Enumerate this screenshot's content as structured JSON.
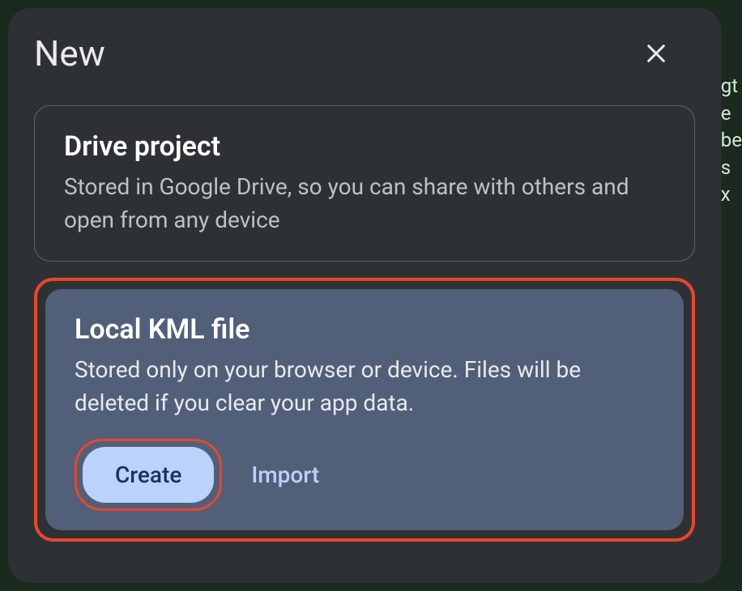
{
  "dialog": {
    "title": "New",
    "options": {
      "drive": {
        "title": "Drive project",
        "description": "Stored in Google Drive, so you can share with others and open from any device"
      },
      "local": {
        "title": "Local KML file",
        "description": "Stored only on your browser or device. Files will be deleted if you clear your app data.",
        "create_label": "Create",
        "import_label": "Import"
      }
    }
  },
  "bg": {
    "l1": "gt",
    "l2": "e",
    "l3": "be",
    "l4": "s",
    "l5": "x"
  }
}
